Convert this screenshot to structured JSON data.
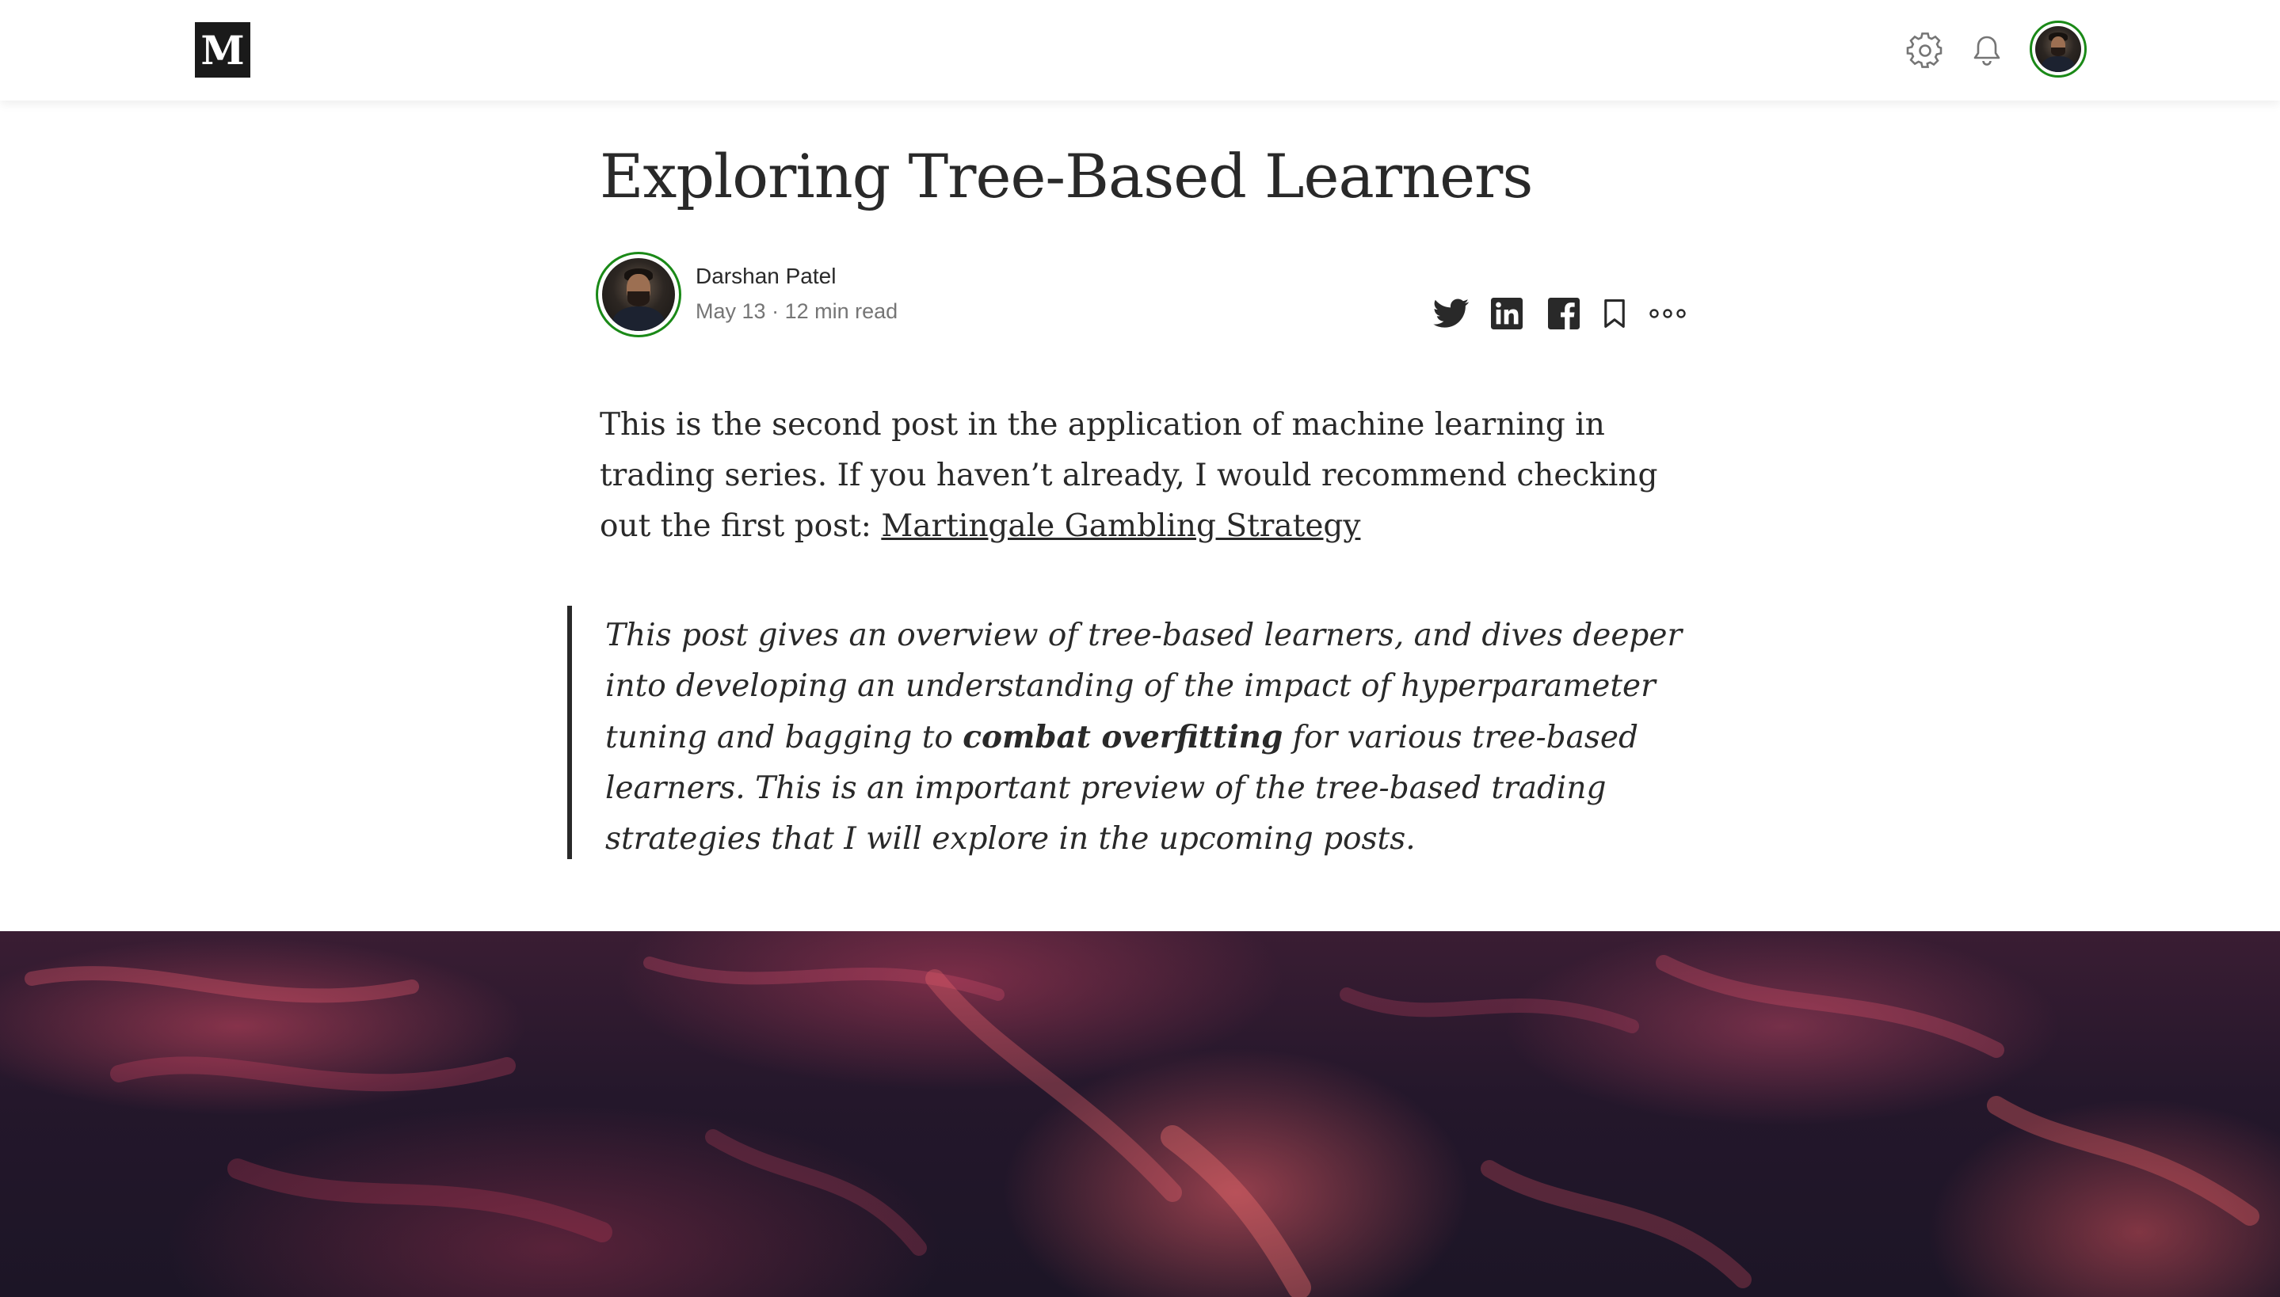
{
  "header": {
    "logo": "M",
    "icons": [
      "settings-icon",
      "bell-icon"
    ],
    "avatar_alt": "Profile"
  },
  "article": {
    "title": "Exploring Tree-Based Learners",
    "author": {
      "name": "Darshan Patel",
      "date": "May 13",
      "separator": "·",
      "read_time": "12 min read"
    },
    "share_icons": [
      "twitter-icon",
      "linkedin-icon",
      "facebook-icon",
      "bookmark-icon",
      "more-icon"
    ],
    "intro": {
      "text": "This is the second post in the application of machine learning in trading series. If you haven’t already, I would recommend checking out the first post: ",
      "link_text": "Martingale Gambling Strategy"
    },
    "quote": {
      "before": "This post gives an overview of tree-based learners, and dives deeper into developing an understanding of the impact of hyperparameter tuning and bagging to ",
      "bold": "combat overfitting",
      "after": " for various tree-based learners. This is an important preview of the tree-based trading strategies that I will explore in the upcoming posts."
    },
    "hero_image": "dark red abstract texture"
  },
  "colors": {
    "accent_green": "#1a8917",
    "text": "#292929",
    "muted": "#757575"
  }
}
